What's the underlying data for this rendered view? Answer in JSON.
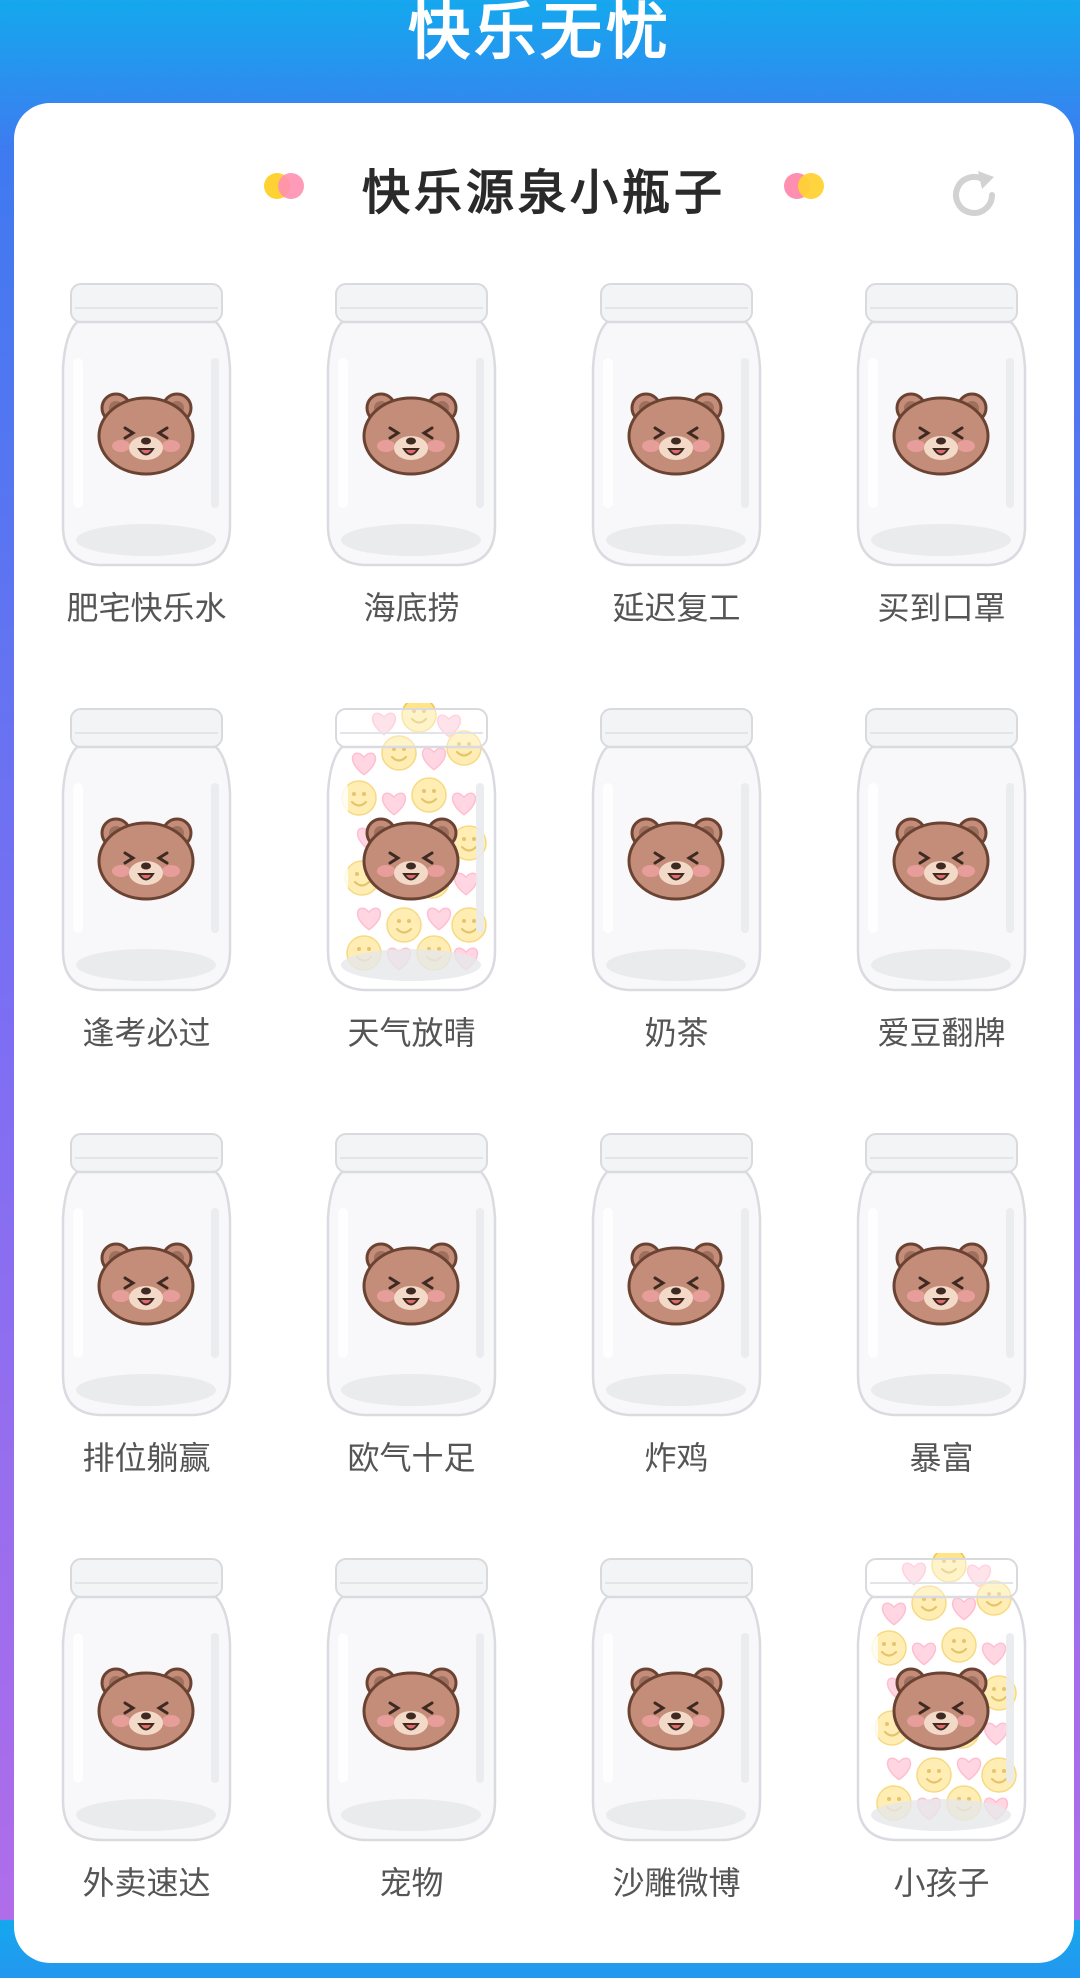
{
  "header": {
    "title": "快乐无忧"
  },
  "card": {
    "title": "快乐源泉小瓶子"
  },
  "colors": {
    "accent_yellow": "#ffd234",
    "accent_pink": "#ff8fb1",
    "bear": "#c48d79"
  },
  "jars": [
    {
      "label": "肥宅快乐水",
      "filled": false
    },
    {
      "label": "海底捞",
      "filled": false
    },
    {
      "label": "延迟复工",
      "filled": false
    },
    {
      "label": "买到口罩",
      "filled": false
    },
    {
      "label": "逢考必过",
      "filled": false
    },
    {
      "label": "天气放晴",
      "filled": true
    },
    {
      "label": "奶茶",
      "filled": false
    },
    {
      "label": "爱豆翻牌",
      "filled": false
    },
    {
      "label": "排位躺赢",
      "filled": false
    },
    {
      "label": "欧气十足",
      "filled": false
    },
    {
      "label": "炸鸡",
      "filled": false
    },
    {
      "label": "暴富",
      "filled": false
    },
    {
      "label": "外卖速达",
      "filled": false
    },
    {
      "label": "宠物",
      "filled": false
    },
    {
      "label": "沙雕微博",
      "filled": false
    },
    {
      "label": "小孩子",
      "filled": true
    }
  ],
  "icons": {
    "refresh": "refresh-icon",
    "jar": "jar-icon",
    "bear": "bear-face-icon"
  }
}
